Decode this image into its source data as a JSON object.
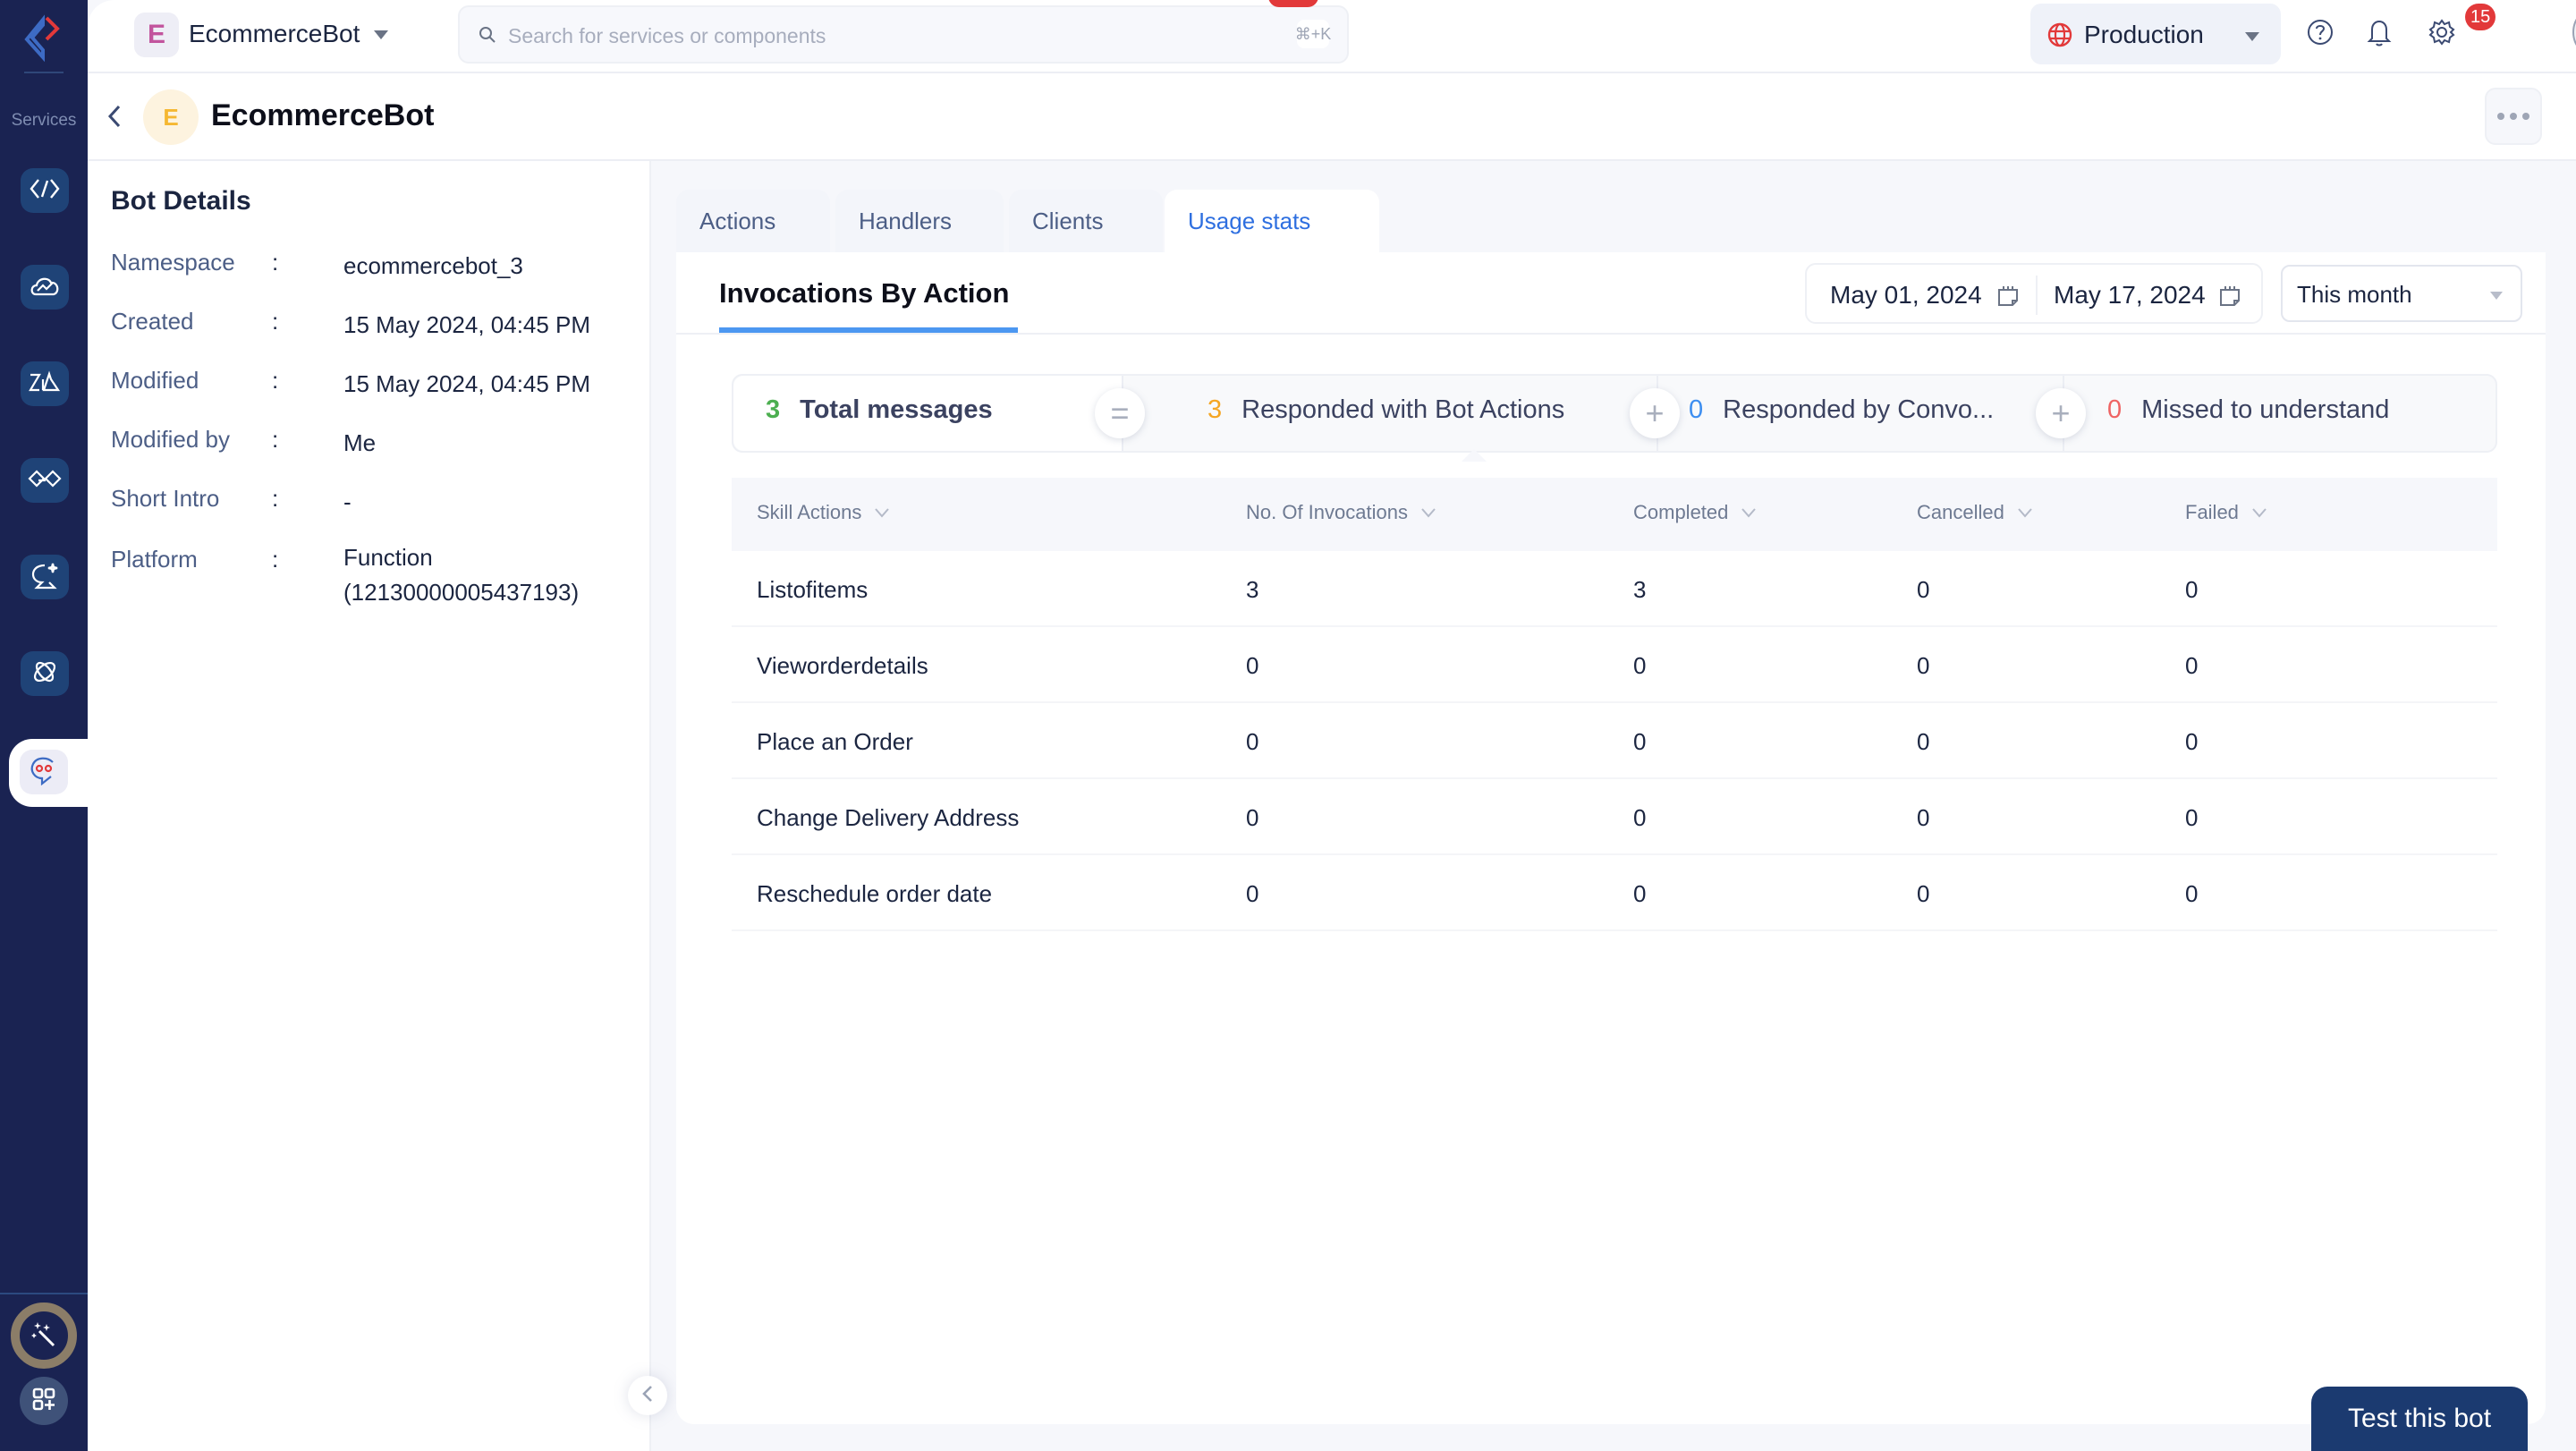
{
  "rail": {
    "label": "Services",
    "items": [
      {
        "icon": "code-brackets-icon"
      },
      {
        "icon": "cloud-analytics-icon"
      },
      {
        "icon": "zia-icon"
      },
      {
        "icon": "handshake-icon"
      },
      {
        "icon": "chat-sparkle-icon"
      },
      {
        "icon": "orbit-link-icon"
      },
      {
        "icon": "chatbot-icon",
        "active": true
      }
    ],
    "bottom": [
      {
        "icon": "magic-wand-icon"
      },
      {
        "icon": "add-apps-icon"
      }
    ]
  },
  "topbar": {
    "project_initial": "E",
    "project_name": "EcommerceBot",
    "search_placeholder": "Search for services or components",
    "search_shortcut": "⌘+K",
    "environment": "Production",
    "notification_count": "15",
    "colors": {
      "accent": "#2e6fe0",
      "nav": "#1a2352",
      "badge": "#e2393a"
    }
  },
  "subheader": {
    "bot_initial": "E",
    "bot_name": "EcommerceBot"
  },
  "details": {
    "title": "Bot Details",
    "separator": ":",
    "fields": [
      {
        "label": "Namespace",
        "value": "ecommercebot_3"
      },
      {
        "label": "Created",
        "value": "15 May 2024, 04:45 PM"
      },
      {
        "label": "Modified",
        "value": "15 May 2024, 04:45 PM"
      },
      {
        "label": "Modified by",
        "value": "Me"
      },
      {
        "label": "Short Intro",
        "value": "-"
      },
      {
        "label": "Platform",
        "value": "Function (12130000005437193)"
      }
    ]
  },
  "tabs": [
    {
      "label": "Actions",
      "active": false
    },
    {
      "label": "Handlers",
      "active": false
    },
    {
      "label": "Clients",
      "active": false
    },
    {
      "label": "Usage stats",
      "active": true
    }
  ],
  "usage": {
    "section_title": "Invocations By Action",
    "start_date": "May 01, 2024",
    "end_date": "May 17, 2024",
    "period": "This month",
    "summary": [
      {
        "value": "3",
        "label": "Total messages",
        "color": "#4caf50"
      },
      {
        "operator": "="
      },
      {
        "value": "3",
        "label": "Responded with Bot Actions",
        "color": "#f5a623"
      },
      {
        "operator": "+"
      },
      {
        "value": "0",
        "label": "Responded by Convo...",
        "color": "#3d8ef0"
      },
      {
        "operator": "+"
      },
      {
        "value": "0",
        "label": "Missed to understand",
        "color": "#ef6464"
      }
    ],
    "table": {
      "columns": [
        "Skill Actions",
        "No. Of Invocations",
        "Completed",
        "Cancelled",
        "Failed"
      ],
      "rows": [
        [
          "Listofitems",
          "3",
          "3",
          "0",
          "0"
        ],
        [
          "Vieworderdetails",
          "0",
          "0",
          "0",
          "0"
        ],
        [
          "Place an Order",
          "0",
          "0",
          "0",
          "0"
        ],
        [
          "Change Delivery Address",
          "0",
          "0",
          "0",
          "0"
        ],
        [
          "Reschedule order date",
          "0",
          "0",
          "0",
          "0"
        ]
      ]
    }
  },
  "test_button": "Test this bot"
}
